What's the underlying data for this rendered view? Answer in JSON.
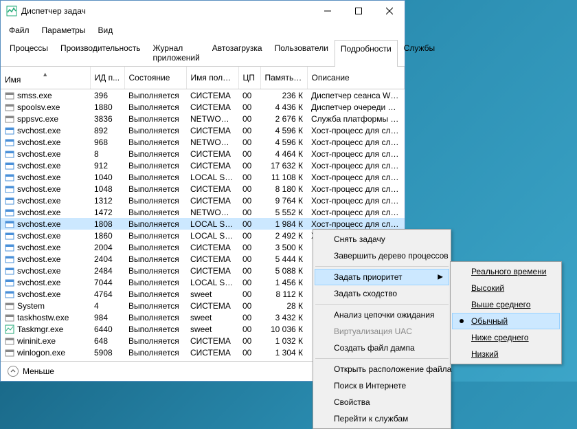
{
  "window": {
    "title": "Диспетчер задач"
  },
  "menubar": [
    "Файл",
    "Параметры",
    "Вид"
  ],
  "tabs": [
    "Процессы",
    "Производительность",
    "Журнал приложений",
    "Автозагрузка",
    "Пользователи",
    "Подробности",
    "Службы"
  ],
  "active_tab": "Подробности",
  "columns": [
    "Имя",
    "ИД п...",
    "Состояние",
    "Имя польз...",
    "ЦП",
    "Память (ч...",
    "Описание"
  ],
  "rows": [
    {
      "name": "smss.exe",
      "pid": "396",
      "state": "Выполняется",
      "user": "СИСТЕМА",
      "cpu": "00",
      "mem": "236 К",
      "desc": "Диспетчер сеанса Win...",
      "icon": "generic"
    },
    {
      "name": "spoolsv.exe",
      "pid": "1880",
      "state": "Выполняется",
      "user": "СИСТЕМА",
      "cpu": "00",
      "mem": "4 436 К",
      "desc": "Диспетчер очереди пе...",
      "icon": "generic"
    },
    {
      "name": "sppsvc.exe",
      "pid": "3836",
      "state": "Выполняется",
      "user": "NETWORK...",
      "cpu": "00",
      "mem": "2 676 К",
      "desc": "Служба платформы за...",
      "icon": "generic"
    },
    {
      "name": "svchost.exe",
      "pid": "892",
      "state": "Выполняется",
      "user": "СИСТЕМА",
      "cpu": "00",
      "mem": "4 596 К",
      "desc": "Хост-процесс для слу...",
      "icon": "svc"
    },
    {
      "name": "svchost.exe",
      "pid": "968",
      "state": "Выполняется",
      "user": "NETWORK...",
      "cpu": "00",
      "mem": "4 596 К",
      "desc": "Хост-процесс для слу...",
      "icon": "svc"
    },
    {
      "name": "svchost.exe",
      "pid": "8",
      "state": "Выполняется",
      "user": "СИСТЕМА",
      "cpu": "00",
      "mem": "4 464 К",
      "desc": "Хост-процесс для слу...",
      "icon": "svc"
    },
    {
      "name": "svchost.exe",
      "pid": "912",
      "state": "Выполняется",
      "user": "СИСТЕМА",
      "cpu": "00",
      "mem": "17 632 К",
      "desc": "Хост-процесс для слу...",
      "icon": "svc"
    },
    {
      "name": "svchost.exe",
      "pid": "1040",
      "state": "Выполняется",
      "user": "LOCAL SE...",
      "cpu": "00",
      "mem": "11 108 К",
      "desc": "Хост-процесс для слу...",
      "icon": "svc"
    },
    {
      "name": "svchost.exe",
      "pid": "1048",
      "state": "Выполняется",
      "user": "СИСТЕМА",
      "cpu": "00",
      "mem": "8 180 К",
      "desc": "Хост-процесс для слу...",
      "icon": "svc"
    },
    {
      "name": "svchost.exe",
      "pid": "1312",
      "state": "Выполняется",
      "user": "СИСТЕМА",
      "cpu": "00",
      "mem": "9 764 К",
      "desc": "Хост-процесс для слу...",
      "icon": "svc"
    },
    {
      "name": "svchost.exe",
      "pid": "1472",
      "state": "Выполняется",
      "user": "NETWORK...",
      "cpu": "00",
      "mem": "5 552 К",
      "desc": "Хост-процесс для слу...",
      "icon": "svc"
    },
    {
      "name": "svchost.exe",
      "pid": "1808",
      "state": "Выполняется",
      "user": "LOCAL SE...",
      "cpu": "00",
      "mem": "1 984 К",
      "desc": "Хост-процесс для слу...",
      "icon": "svc",
      "selected": true
    },
    {
      "name": "svchost.exe",
      "pid": "1860",
      "state": "Выполняется",
      "user": "LOCAL SE...",
      "cpu": "00",
      "mem": "2 492 К",
      "desc": "Хост-процесс для слу...",
      "icon": "svc"
    },
    {
      "name": "svchost.exe",
      "pid": "2004",
      "state": "Выполняется",
      "user": "СИСТЕМА",
      "cpu": "00",
      "mem": "3 500 К",
      "desc": "",
      "icon": "svc"
    },
    {
      "name": "svchost.exe",
      "pid": "2404",
      "state": "Выполняется",
      "user": "СИСТЕМА",
      "cpu": "00",
      "mem": "5 444 К",
      "desc": "",
      "icon": "svc"
    },
    {
      "name": "svchost.exe",
      "pid": "2484",
      "state": "Выполняется",
      "user": "СИСТЕМА",
      "cpu": "00",
      "mem": "5 088 К",
      "desc": "",
      "icon": "svc"
    },
    {
      "name": "svchost.exe",
      "pid": "7044",
      "state": "Выполняется",
      "user": "LOCAL SE...",
      "cpu": "00",
      "mem": "1 456 К",
      "desc": "",
      "icon": "svc"
    },
    {
      "name": "svchost.exe",
      "pid": "4764",
      "state": "Выполняется",
      "user": "sweet",
      "cpu": "00",
      "mem": "8 112 К",
      "desc": "",
      "icon": "svc"
    },
    {
      "name": "System",
      "pid": "4",
      "state": "Выполняется",
      "user": "СИСТЕМА",
      "cpu": "00",
      "mem": "28 К",
      "desc": "",
      "icon": "generic"
    },
    {
      "name": "taskhostw.exe",
      "pid": "984",
      "state": "Выполняется",
      "user": "sweet",
      "cpu": "00",
      "mem": "3 432 К",
      "desc": "",
      "icon": "generic"
    },
    {
      "name": "Taskmgr.exe",
      "pid": "6440",
      "state": "Выполняется",
      "user": "sweet",
      "cpu": "00",
      "mem": "10 036 К",
      "desc": "",
      "icon": "tm"
    },
    {
      "name": "wininit.exe",
      "pid": "648",
      "state": "Выполняется",
      "user": "СИСТЕМА",
      "cpu": "00",
      "mem": "1 032 К",
      "desc": "",
      "icon": "generic"
    },
    {
      "name": "winlogon.exe",
      "pid": "5908",
      "state": "Выполняется",
      "user": "СИСТЕМА",
      "cpu": "00",
      "mem": "1 304 К",
      "desc": "",
      "icon": "generic"
    }
  ],
  "statusbar": {
    "fewer": "Меньше"
  },
  "context_menu": {
    "items": [
      {
        "label": "Снять задачу"
      },
      {
        "label": "Завершить дерево процессов"
      },
      {
        "sep": true
      },
      {
        "label": "Задать приоритет",
        "submenu": true,
        "hover": true
      },
      {
        "label": "Задать сходство"
      },
      {
        "sep": true
      },
      {
        "label": "Анализ цепочки ожидания"
      },
      {
        "label": "Виртуализация UAC",
        "disabled": true
      },
      {
        "label": "Создать файл дампа"
      },
      {
        "sep": true
      },
      {
        "label": "Открыть расположение файла"
      },
      {
        "label": "Поиск в Интернете"
      },
      {
        "label": "Свойства"
      },
      {
        "label": "Перейти к службам"
      }
    ]
  },
  "priority_submenu": {
    "items": [
      {
        "label": "Реального времени"
      },
      {
        "label": "Высокий"
      },
      {
        "label": "Выше среднего"
      },
      {
        "label": "Обычный",
        "checked": true,
        "hover": true
      },
      {
        "label": "Ниже среднего"
      },
      {
        "label": "Низкий"
      }
    ]
  }
}
